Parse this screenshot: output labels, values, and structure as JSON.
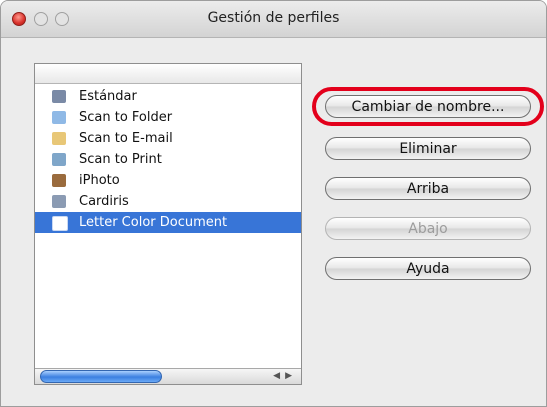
{
  "window": {
    "title": "Gestión de perfiles"
  },
  "profiles": [
    {
      "label": "Estándar",
      "icon": "scanner-icon",
      "color": "#7a8aa6",
      "selected": false
    },
    {
      "label": "Scan to Folder",
      "icon": "folder-icon",
      "color": "#8fb9e6",
      "selected": false
    },
    {
      "label": "Scan to E-mail",
      "icon": "mail-icon",
      "color": "#e8c777",
      "selected": false
    },
    {
      "label": "Scan to Print",
      "icon": "printer-icon",
      "color": "#7fa6c9",
      "selected": false
    },
    {
      "label": "iPhoto",
      "icon": "iphoto-icon",
      "color": "#9a6b3d",
      "selected": false
    },
    {
      "label": "Cardiris",
      "icon": "cardiris-icon",
      "color": "#8b9bb3",
      "selected": false
    },
    {
      "label": "Letter Color Document",
      "icon": "scanner-icon",
      "color": "#ffffff",
      "selected": true
    }
  ],
  "buttons": {
    "rename": "Cambiar de nombre...",
    "delete": "Eliminar",
    "up": "Arriba",
    "down": "Abajo",
    "help": "Ayuda"
  },
  "colors": {
    "selection": "#3875d7",
    "highlight_ring": "#e3001b"
  }
}
